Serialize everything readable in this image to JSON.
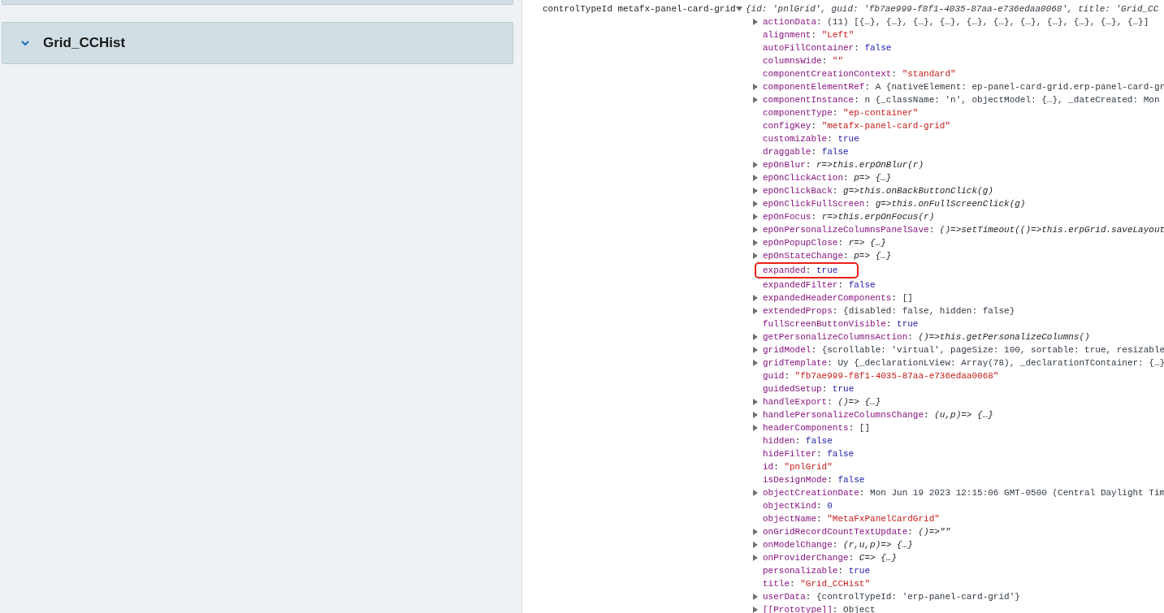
{
  "left_panel": {
    "cards": [
      {
        "title": "Grid_CCHist",
        "expanded": true
      }
    ]
  },
  "console": {
    "label": "controlTypeId metafx-panel-card-grid",
    "expanded": true,
    "separator": ":",
    "summary": "{id: 'pnlGrid', guid: 'fb7ae999-f8f1-4035-87aa-e736edaa0068', title: 'Grid_CC",
    "properties": [
      {
        "name": "actionData",
        "value": "(11) [{…}, {…}, {…}, {…}, {…}, {…}, {…}, {…}, {…}, {…}, {…}]",
        "kind": "object",
        "expandable": true,
        "highlighted": false
      },
      {
        "name": "alignment",
        "value": "\"Left\"",
        "kind": "string",
        "expandable": false,
        "highlighted": false
      },
      {
        "name": "autoFillContainer",
        "value": "false",
        "kind": "literal",
        "expandable": false,
        "highlighted": false
      },
      {
        "name": "columnsWide",
        "value": "\"\"",
        "kind": "string",
        "expandable": false,
        "highlighted": false
      },
      {
        "name": "componentCreationContext",
        "value": "\"standard\"",
        "kind": "string",
        "expandable": false,
        "highlighted": false
      },
      {
        "name": "componentElementRef",
        "value": "A {nativeElement: ep-panel-card-grid.erp-panel-card-gr",
        "kind": "object",
        "expandable": true,
        "highlighted": false
      },
      {
        "name": "componentInstance",
        "value": "n {_className: 'n', objectModel: {…}, _dateCreated: Mon",
        "kind": "object",
        "expandable": true,
        "highlighted": false
      },
      {
        "name": "componentType",
        "value": "\"ep-container\"",
        "kind": "string",
        "expandable": false,
        "highlighted": false
      },
      {
        "name": "configKey",
        "value": "\"metafx-panel-card-grid\"",
        "kind": "string",
        "expandable": false,
        "highlighted": false
      },
      {
        "name": "customizable",
        "value": "true",
        "kind": "literal",
        "expandable": false,
        "highlighted": false
      },
      {
        "name": "draggable",
        "value": "false",
        "kind": "literal",
        "expandable": false,
        "highlighted": false
      },
      {
        "name": "epOnBlur",
        "value": "r=>this.erpOnBlur(r)",
        "kind": "function",
        "expandable": true,
        "highlighted": false
      },
      {
        "name": "epOnClickAction",
        "value": "p=> {…}",
        "kind": "function",
        "expandable": true,
        "highlighted": false
      },
      {
        "name": "epOnClickBack",
        "value": "g=>this.onBackButtonClick(g)",
        "kind": "function",
        "expandable": true,
        "highlighted": false
      },
      {
        "name": "epOnClickFullScreen",
        "value": "g=>this.onFullScreenClick(g)",
        "kind": "function",
        "expandable": true,
        "highlighted": false
      },
      {
        "name": "epOnFocus",
        "value": "r=>this.erpOnFocus(r)",
        "kind": "function",
        "expandable": true,
        "highlighted": false
      },
      {
        "name": "epOnPersonalizeColumnsPanelSave",
        "value": "()=>setTimeout(()=>this.erpGrid.saveLayout",
        "kind": "function",
        "expandable": true,
        "highlighted": false
      },
      {
        "name": "epOnPopupClose",
        "value": "r=> {…}",
        "kind": "function",
        "expandable": true,
        "highlighted": false
      },
      {
        "name": "epOnStateChange",
        "value": "p=> {…}",
        "kind": "function",
        "expandable": true,
        "highlighted": false
      },
      {
        "name": "expanded",
        "value": "true",
        "kind": "literal",
        "expandable": false,
        "highlighted": true
      },
      {
        "name": "expandedFilter",
        "value": "false",
        "kind": "literal",
        "expandable": false,
        "highlighted": false
      },
      {
        "name": "expandedHeaderComponents",
        "value": "[]",
        "kind": "object",
        "expandable": true,
        "highlighted": false
      },
      {
        "name": "extendedProps",
        "value": "{disabled: false, hidden: false}",
        "kind": "object",
        "expandable": true,
        "highlighted": false
      },
      {
        "name": "fullScreenButtonVisible",
        "value": "true",
        "kind": "literal",
        "expandable": false,
        "highlighted": false
      },
      {
        "name": "getPersonalizeColumnsAction",
        "value": "()=>this.getPersonalizeColumns()",
        "kind": "function",
        "expandable": true,
        "highlighted": false
      },
      {
        "name": "gridModel",
        "value": "{scrollable: 'virtual', pageSize: 100, sortable: true, resizable",
        "kind": "object",
        "expandable": true,
        "highlighted": false
      },
      {
        "name": "gridTemplate",
        "value": "Uy {_declarationLView: Array(78), _declarationTContainer: {…}",
        "kind": "object",
        "expandable": true,
        "highlighted": false
      },
      {
        "name": "guid",
        "value": "\"fb7ae999-f8f1-4035-87aa-e736edaa0068\"",
        "kind": "string",
        "expandable": false,
        "highlighted": false
      },
      {
        "name": "guidedSetup",
        "value": "true",
        "kind": "literal",
        "expandable": false,
        "highlighted": false
      },
      {
        "name": "handleExport",
        "value": "()=> {…}",
        "kind": "function",
        "expandable": true,
        "highlighted": false
      },
      {
        "name": "handlePersonalizeColumnsChange",
        "value": "(u,p)=> {…}",
        "kind": "function",
        "expandable": true,
        "highlighted": false
      },
      {
        "name": "headerComponents",
        "value": "[]",
        "kind": "object",
        "expandable": true,
        "highlighted": false
      },
      {
        "name": "hidden",
        "value": "false",
        "kind": "literal",
        "expandable": false,
        "highlighted": false
      },
      {
        "name": "hideFilter",
        "value": "false",
        "kind": "literal",
        "expandable": false,
        "highlighted": false
      },
      {
        "name": "id",
        "value": "\"pnlGrid\"",
        "kind": "string",
        "expandable": false,
        "highlighted": false
      },
      {
        "name": "isDesignMode",
        "value": "false",
        "kind": "literal",
        "expandable": false,
        "highlighted": false
      },
      {
        "name": "objectCreationDate",
        "value": "Mon Jun 19 2023 12:15:06 GMT-0500 (Central Daylight Tim",
        "kind": "object",
        "expandable": true,
        "highlighted": false
      },
      {
        "name": "objectKind",
        "value": "0",
        "kind": "literal",
        "expandable": false,
        "highlighted": false
      },
      {
        "name": "objectName",
        "value": "\"MetaFxPanelCardGrid\"",
        "kind": "string",
        "expandable": false,
        "highlighted": false
      },
      {
        "name": "onGridRecordCountTextUpdate",
        "value": "()=>\"\"",
        "kind": "function",
        "expandable": true,
        "highlighted": false
      },
      {
        "name": "onModelChange",
        "value": "(r,u,p)=> {…}",
        "kind": "function",
        "expandable": true,
        "highlighted": false
      },
      {
        "name": "onProviderChange",
        "value": "C=> {…}",
        "kind": "function",
        "expandable": true,
        "highlighted": false
      },
      {
        "name": "personalizable",
        "value": "true",
        "kind": "literal",
        "expandable": false,
        "highlighted": false
      },
      {
        "name": "title",
        "value": "\"Grid_CCHist\"",
        "kind": "string",
        "expandable": false,
        "highlighted": false
      },
      {
        "name": "userData",
        "value": "{controlTypeId: 'erp-panel-card-grid'}",
        "kind": "object",
        "expandable": true,
        "highlighted": false
      },
      {
        "name": "[[Prototype]]",
        "value": "Object",
        "kind": "object",
        "expandable": true,
        "highlighted": false
      }
    ]
  }
}
